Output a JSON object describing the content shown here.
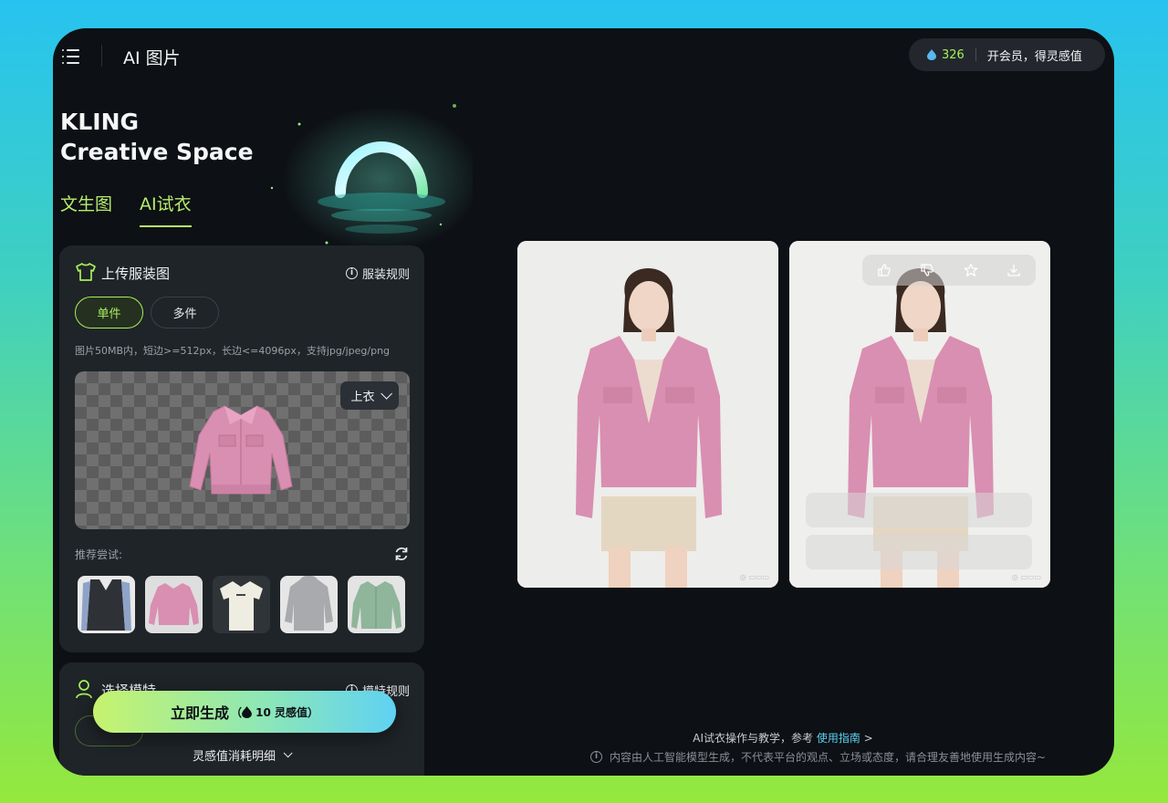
{
  "header": {
    "app_title": "AI 图片",
    "credits": "326",
    "membership_cta": "开会员，得灵感值"
  },
  "hero": {
    "brand_line1": "KLING",
    "brand_line2": "Creative Space"
  },
  "tabs": [
    {
      "label": "文生图",
      "active": false
    },
    {
      "label": "AI试衣",
      "active": true
    }
  ],
  "upload_panel": {
    "title": "上传服装图",
    "rules_label": "服装规则",
    "modes": [
      "单件",
      "多件"
    ],
    "selected_mode": "单件",
    "hint": "图片50MB内，短边>=512px，长边<=4096px，支持jpg/jpeg/png",
    "category": "上衣",
    "recommend_label": "推荐尝试:",
    "recommended_items": [
      "black-vest",
      "pink-denim-jacket",
      "white-polo-shirt",
      "grey-hoodie",
      "green-denim-jacket"
    ]
  },
  "model_panel": {
    "title": "选择模特",
    "rules_label": "模特规则"
  },
  "generate": {
    "label": "立即生成",
    "cost": "10 灵感值"
  },
  "cost_details_label": "灵感值消耗明细",
  "footer": {
    "tutorial_prefix": "AI试衣操作与教学，参考",
    "tutorial_link": "使用指南",
    "tutorial_suffix": ">",
    "disclaimer": "内容由人工智能模型生成，不代表平台的观点、立场或态度，请合理友善地使用生成内容~"
  },
  "colors": {
    "accent_green": "#a6f05a",
    "link_cyan": "#5ad2f0",
    "window_bg": "#0d1014",
    "panel_bg": "#1f2428"
  }
}
